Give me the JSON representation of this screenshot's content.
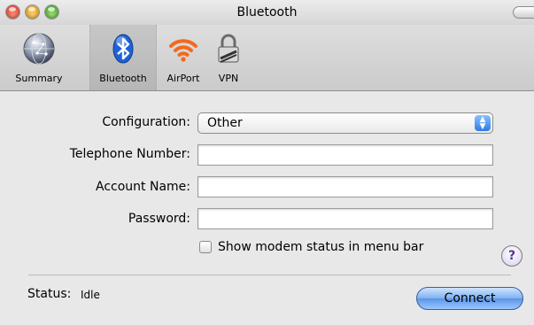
{
  "window": {
    "title": "Bluetooth"
  },
  "toolbar": {
    "items": [
      {
        "label": "Summary",
        "icon": "network-globe-icon"
      },
      {
        "label": "Bluetooth",
        "icon": "bluetooth-icon",
        "selected": true
      },
      {
        "label": "AirPort",
        "icon": "airport-wifi-icon"
      },
      {
        "label": "VPN",
        "icon": "vpn-lock-icon"
      }
    ]
  },
  "form": {
    "configuration_label": "Configuration:",
    "configuration_value": "Other",
    "telephone_label": "Telephone Number:",
    "telephone_value": "",
    "account_label": "Account Name:",
    "account_value": "",
    "password_label": "Password:",
    "password_value": "",
    "show_status_label": "Show modem status in menu bar",
    "show_status_checked": false
  },
  "help": {
    "glyph": "?"
  },
  "status": {
    "label": "Status:",
    "value": "Idle"
  },
  "actions": {
    "connect_label": "Connect"
  },
  "colors": {
    "accent_blue": "#5b95e6",
    "bluetooth_blue": "#1f62d6",
    "airport_orange": "#f26a1b",
    "help_purple": "#5a2d9a"
  }
}
